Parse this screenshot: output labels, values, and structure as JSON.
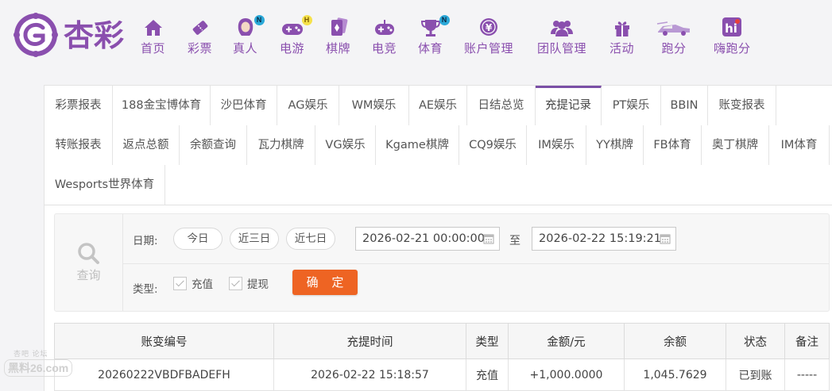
{
  "brand": {
    "name": "杏彩",
    "color": "#8a4fae"
  },
  "nav": [
    {
      "label": "首页",
      "icon": "home-icon"
    },
    {
      "label": "彩票",
      "icon": "ticket-icon"
    },
    {
      "label": "真人",
      "icon": "dealer-icon",
      "badge": "N"
    },
    {
      "label": "电游",
      "icon": "gamepad-icon",
      "badge": "H"
    },
    {
      "label": "棋牌",
      "icon": "cards-icon"
    },
    {
      "label": "电竞",
      "icon": "esports-icon"
    },
    {
      "label": "体育",
      "icon": "trophy-icon",
      "badge": "N"
    },
    {
      "label": "账户管理",
      "icon": "yen-coin-icon"
    },
    {
      "label": "团队管理",
      "icon": "team-icon"
    },
    {
      "label": "活动",
      "icon": "gift-icon"
    },
    {
      "label": "跑分",
      "icon": "race-car-icon"
    },
    {
      "label": "嗨跑分",
      "icon": "hi-app-icon"
    }
  ],
  "tabs": [
    "彩票报表",
    "188金宝博体育",
    "沙巴体育",
    "AG娱乐",
    "WM娱乐",
    "AE娱乐",
    "日结总览",
    "充提记录",
    "PT娱乐",
    "BBIN",
    "账变报表",
    "转账报表",
    "返点总额",
    "余额查询",
    "瓦力棋牌",
    "VG娱乐",
    "Kgame棋牌",
    "CQ9娱乐",
    "IM娱乐",
    "YY棋牌",
    "FB体育",
    "奥丁棋牌",
    "IM体育",
    "Wesports世界体育"
  ],
  "active_tab": "充提记录",
  "filter": {
    "query_label": "查询",
    "date_label": "日期:",
    "quick_ranges": [
      "今日",
      "近三日",
      "近七日"
    ],
    "date_from": "2026-02-21 00:00:00",
    "to_label": "至",
    "date_to": "2026-02-22 15:19:21",
    "type_label": "类型:",
    "types": [
      "充值",
      "提现"
    ],
    "confirm_label": "确 定"
  },
  "table": {
    "headers": [
      "账变编号",
      "充提时间",
      "类型",
      "金额/元",
      "余额",
      "状态",
      "备注"
    ],
    "rows": [
      {
        "id": "20260222VBDFBADEFH",
        "time": "2026-02-22 15:18:57",
        "type": "充值",
        "amount": "+1,000.0000",
        "balance": "1,045.7629",
        "status": "已到账",
        "note": "-----"
      }
    ]
  },
  "colors": {
    "accent": "#8a4fae",
    "tab_active": "#7b4fa6",
    "confirm": "#ee6423",
    "amount": "#e23a2c",
    "success": "#2e9f2e"
  },
  "watermark": {
    "top": "杏吧   论坛",
    "bottom": "黑料26.com"
  }
}
